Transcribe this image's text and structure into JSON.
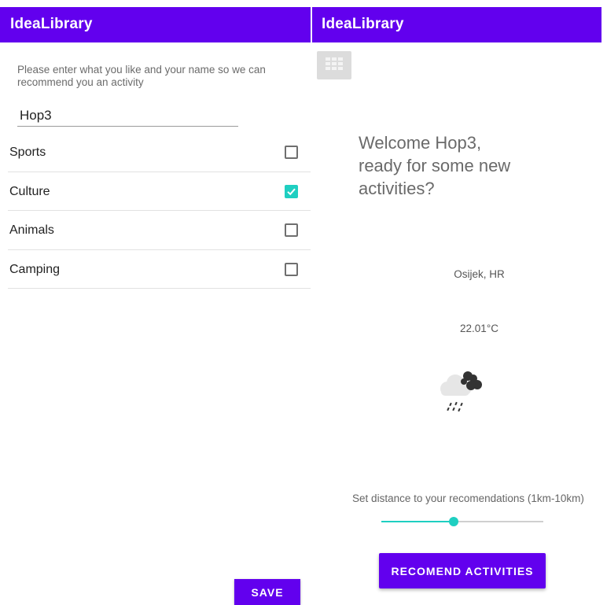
{
  "left_screen": {
    "app_title": "IdeaLibrary",
    "prompt": "Please enter what you like and your name so we can recommend you an activity",
    "name_input": {
      "value": "Hop3"
    },
    "categories": [
      {
        "label": "Sports",
        "checked": false
      },
      {
        "label": "Culture",
        "checked": true
      },
      {
        "label": "Animals",
        "checked": false
      },
      {
        "label": "Camping",
        "checked": false
      }
    ],
    "save_label": "SAVE"
  },
  "right_screen": {
    "app_title": "IdeaLibrary",
    "keypad_icon": "keypad-icon",
    "welcome": "Welcome Hop3,\nready for some new activities?",
    "location": "Osijek, HR",
    "temperature": "22.01°C",
    "weather_icon": "rain-cloud-icon",
    "distance_label": "Set distance to your recomendations (1km-10km)",
    "distance_slider": {
      "min": 1,
      "max": 10,
      "value": 5
    },
    "recommend_label": "RECOMEND ACTIVITIES"
  },
  "colors": {
    "primary": "#6200ee",
    "accent": "#1fcfc1"
  }
}
